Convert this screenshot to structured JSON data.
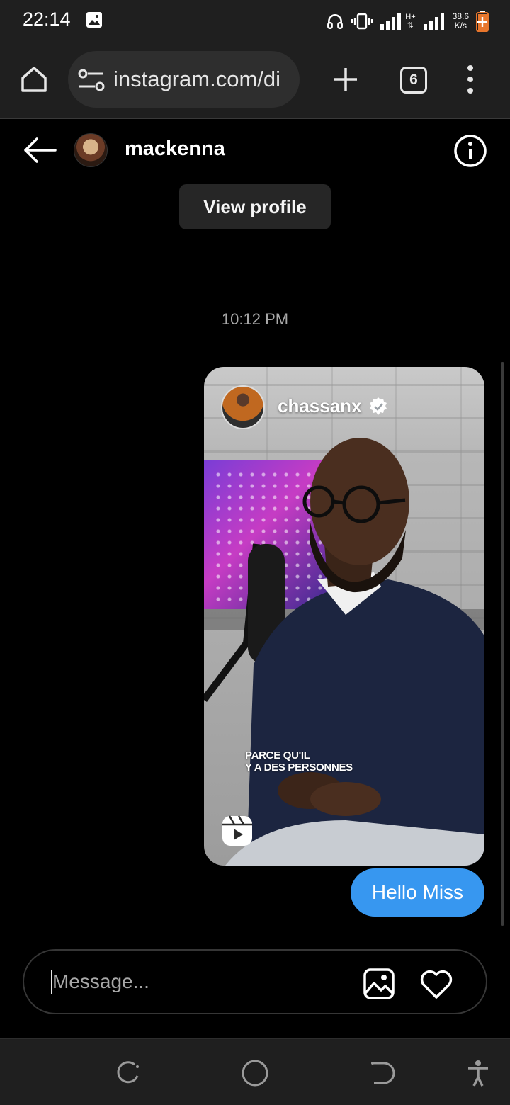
{
  "status_bar": {
    "time": "22:14",
    "net_speed_value": "38.6",
    "net_speed_unit": "K/s",
    "network_type": "H+"
  },
  "browser": {
    "url": "instagram.com/di",
    "tab_count": "6"
  },
  "chat_header": {
    "username": "mackenna"
  },
  "thread": {
    "view_profile_label": "View profile",
    "timestamp": "10:12 PM",
    "shared_reel": {
      "username": "chassanx",
      "caption_line1": "PARCE QU'IL",
      "caption_line2": "Y A DES PERSONNES"
    },
    "messages": [
      {
        "text": "Hello Miss",
        "sender": "me"
      }
    ]
  },
  "composer": {
    "placeholder": "Message..."
  },
  "colors": {
    "bubble": "#3797f0",
    "background": "#000000",
    "chrome": "#1f1f1f"
  },
  "icons": [
    "gallery-icon",
    "headphones-icon",
    "vibrate-icon",
    "signal-icon",
    "battery-icon",
    "home-icon",
    "site-settings-icon",
    "plus-icon",
    "tabs-icon",
    "more-vert-icon",
    "back-arrow-icon",
    "info-icon",
    "verified-badge-icon",
    "reels-icon",
    "image-icon",
    "heart-icon",
    "recents-icon",
    "home-nav-icon",
    "back-nav-icon",
    "accessibility-icon"
  ]
}
